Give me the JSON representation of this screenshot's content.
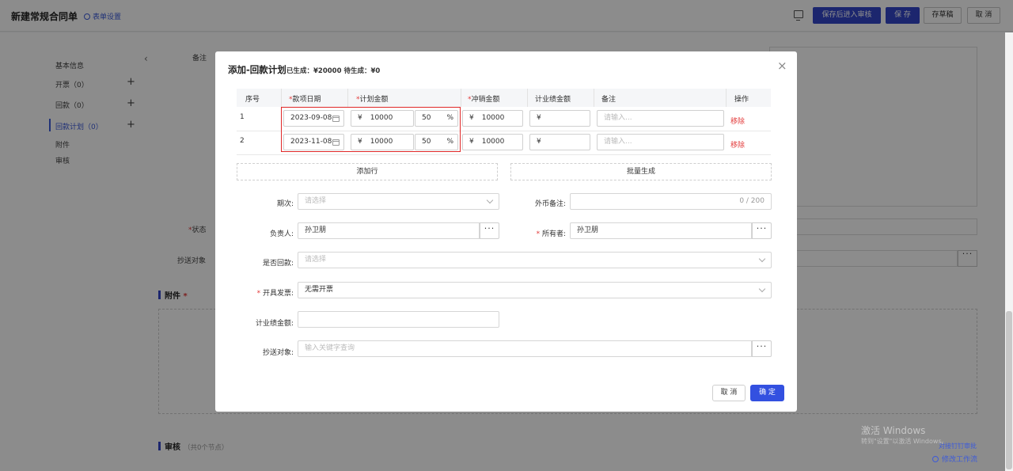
{
  "topbar": {
    "title": "新建常规合同单",
    "form_settings": "表单设置",
    "buttons": {
      "save_and_review": "保存后进入审核",
      "save": "保 存",
      "draft": "存草稿",
      "cancel": "取 消"
    }
  },
  "leftnav": {
    "items": [
      {
        "label": "基本信息"
      },
      {
        "label": "开票（0）"
      },
      {
        "label": "回款（0）"
      },
      {
        "label": "回款计划（0）"
      },
      {
        "label": "附件"
      },
      {
        "label": "审核"
      }
    ]
  },
  "background": {
    "remark_label": "备注",
    "status_label": "状态",
    "cc_label": "抄送对象",
    "attachment_section": "附件",
    "review_section": "审核",
    "review_sub": "（共0个节点）",
    "bottom_link1": "对接钉钉审批",
    "bottom_link2": "修改工作流",
    "watermark1": "激活 Windows",
    "watermark2": "转到\"设置\"以激活 Windows。"
  },
  "modal": {
    "title": "添加-回款计划",
    "stats": "已生成：¥20000  待生成：¥0",
    "table": {
      "headers": {
        "no": "序号",
        "date": "款项日期",
        "amount": "计划金额",
        "offset": "冲销金额",
        "perf": "计业绩金额",
        "remark": "备注",
        "op": "操作"
      },
      "currency": "¥",
      "percent_sign": "%",
      "remark_placeholder": "请输入...",
      "remove_label": "移除",
      "rows": [
        {
          "no": "1",
          "date": "2023-09-08",
          "amount": "10000",
          "pct": "50",
          "offset": "10000",
          "perf": ""
        },
        {
          "no": "2",
          "date": "2023-11-08",
          "amount": "10000",
          "pct": "50",
          "offset": "10000",
          "perf": ""
        }
      ]
    },
    "add_row": "添加行",
    "batch_generate": "批量生成",
    "form": {
      "period_label": "期次:",
      "period_placeholder": "请选择",
      "fx_remark_label": "外币备注:",
      "fx_remark_count": "0 / 200",
      "owner_label": "负责人:",
      "owner_value": "孙卫朋",
      "holder_label": "所有者:",
      "holder_value": "孙卫朋",
      "is_paid_label": "是否回款:",
      "is_paid_placeholder": "请选择",
      "invoice_label": "开具发票:",
      "invoice_value": "无需开票",
      "perf_amount_label": "计业绩金额:",
      "cc_label": "抄送对象:",
      "cc_placeholder": "输入关键字查询"
    },
    "buttons": {
      "cancel": "取 消",
      "confirm": "确 定"
    }
  }
}
